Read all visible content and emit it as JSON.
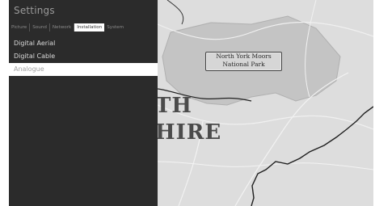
{
  "settings": {
    "title": "Settings",
    "tabs": [
      {
        "label": "Picture",
        "active": false
      },
      {
        "label": "Sound",
        "active": false
      },
      {
        "label": "Network",
        "active": false
      },
      {
        "label": "Installation",
        "active": true
      },
      {
        "label": "System",
        "active": false
      }
    ],
    "menu": [
      {
        "label": "Digital Aerial",
        "selected": false
      },
      {
        "label": "Digital Cable",
        "selected": false
      },
      {
        "label": "Analogue",
        "selected": true
      }
    ]
  },
  "background_map": {
    "park_label_line1": "North York Moors",
    "park_label_line2": "National Park",
    "county_text_line1": "TH",
    "county_text_line2": "HIRE"
  }
}
